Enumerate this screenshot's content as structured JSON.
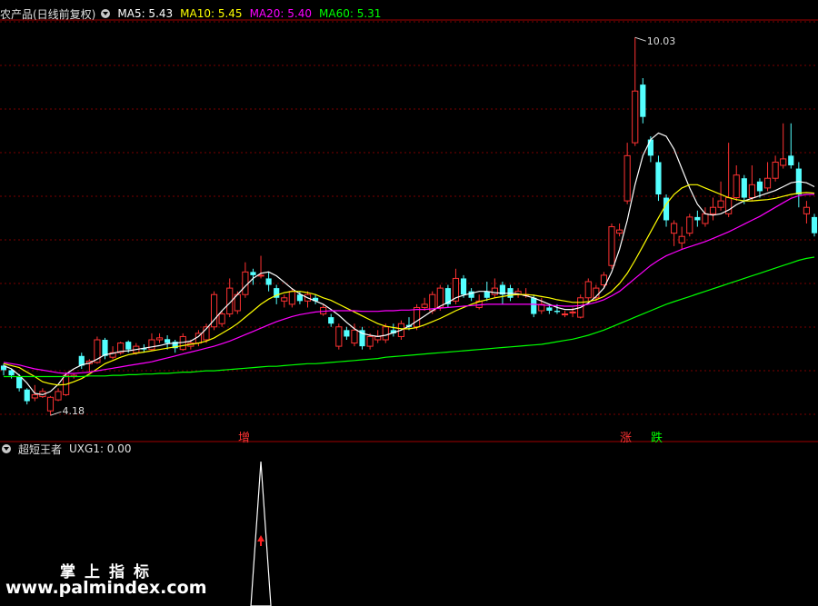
{
  "header": {
    "title": "农产品(日线前复权)",
    "ma5": "MA5: 5.43",
    "ma10": "MA10: 5.45",
    "ma20": "MA20: 5.40",
    "ma60": "MA60: 5.31",
    "colors": {
      "title": "#e0e0e0",
      "ma5": "#ffffff",
      "ma10": "#ffff00",
      "ma20": "#ff00ff",
      "ma60": "#00ff00"
    }
  },
  "indicator": {
    "name": "超短王者",
    "value": "UXG1: 0.00"
  },
  "signals": {
    "zeng": "增",
    "zhang": "涨",
    "die": "跌"
  },
  "watermark": {
    "line1": "掌上指标",
    "line2": "www.palmindex.com"
  },
  "chart_data": {
    "type": "candlestick",
    "ylim": [
      4.0,
      10.3
    ],
    "high_label": "10.03",
    "low_label": "4.18",
    "up_color": "#ff3232",
    "down_color": "#54ffff",
    "candles": [
      [
        4.95,
        4.88,
        4.98,
        4.8
      ],
      [
        4.88,
        4.8,
        4.9,
        4.75
      ],
      [
        4.78,
        4.6,
        4.82,
        4.55
      ],
      [
        4.58,
        4.4,
        4.6,
        4.35
      ],
      [
        4.45,
        4.5,
        4.65,
        4.4
      ],
      [
        4.47,
        4.55,
        4.6,
        4.45
      ],
      [
        4.25,
        4.46,
        4.48,
        4.18
      ],
      [
        4.42,
        4.55,
        4.6,
        4.4
      ],
      [
        4.5,
        4.8,
        4.85,
        4.48
      ],
      [
        4.78,
        4.8,
        4.82,
        4.75
      ],
      [
        5.1,
        4.95,
        5.15,
        4.9
      ],
      [
        4.98,
        5.02,
        5.05,
        4.85
      ],
      [
        5.0,
        5.35,
        5.4,
        4.98
      ],
      [
        5.35,
        5.1,
        5.38,
        5.05
      ],
      [
        5.08,
        5.15,
        5.25,
        5.05
      ],
      [
        5.15,
        5.3,
        5.32,
        5.12
      ],
      [
        5.32,
        5.2,
        5.34,
        5.15
      ],
      [
        5.15,
        5.25,
        5.3,
        5.12
      ],
      [
        5.22,
        5.2,
        5.28,
        5.15
      ],
      [
        5.2,
        5.35,
        5.45,
        5.18
      ],
      [
        5.35,
        5.38,
        5.45,
        5.3
      ],
      [
        5.36,
        5.3,
        5.42,
        5.2
      ],
      [
        5.32,
        5.22,
        5.35,
        5.15
      ],
      [
        5.2,
        5.4,
        5.45,
        5.18
      ],
      [
        5.25,
        5.3,
        5.35,
        5.2
      ],
      [
        5.3,
        5.45,
        5.5,
        5.25
      ],
      [
        5.35,
        5.55,
        5.6,
        5.3
      ],
      [
        5.55,
        6.05,
        6.1,
        5.5
      ],
      [
        5.6,
        5.75,
        5.8,
        5.55
      ],
      [
        5.75,
        6.15,
        6.3,
        5.7
      ],
      [
        5.8,
        6.05,
        6.1,
        5.75
      ],
      [
        6.05,
        6.4,
        6.55,
        6.0
      ],
      [
        6.4,
        6.35,
        6.45,
        6.2
      ],
      [
        6.35,
        6.35,
        6.65,
        6.3
      ],
      [
        6.3,
        6.2,
        6.4,
        6.1
      ],
      [
        6.15,
        6.0,
        6.2,
        5.9
      ],
      [
        5.95,
        6.0,
        6.05,
        5.85
      ],
      [
        5.9,
        6.1,
        6.15,
        5.85
      ],
      [
        6.05,
        5.95,
        6.1,
        5.9
      ],
      [
        5.95,
        6.05,
        6.1,
        5.85
      ],
      [
        6.0,
        5.95,
        6.05,
        5.9
      ],
      [
        5.75,
        5.85,
        5.9,
        5.72
      ],
      [
        5.7,
        5.6,
        5.75,
        5.55
      ],
      [
        5.25,
        5.55,
        5.6,
        5.2
      ],
      [
        5.5,
        5.4,
        5.55,
        5.35
      ],
      [
        5.3,
        5.5,
        5.6,
        5.25
      ],
      [
        5.5,
        5.25,
        5.55,
        5.2
      ],
      [
        5.25,
        5.4,
        5.45,
        5.2
      ],
      [
        5.35,
        5.4,
        5.5,
        5.3
      ],
      [
        5.35,
        5.55,
        5.6,
        5.3
      ],
      [
        5.5,
        5.45,
        5.6,
        5.4
      ],
      [
        5.4,
        5.6,
        5.65,
        5.35
      ],
      [
        5.58,
        5.55,
        5.7,
        5.5
      ],
      [
        5.55,
        5.85,
        5.9,
        5.5
      ],
      [
        5.85,
        5.9,
        6.0,
        5.8
      ],
      [
        5.8,
        6.05,
        6.1,
        5.75
      ],
      [
        5.85,
        6.15,
        6.2,
        5.8
      ],
      [
        6.15,
        5.9,
        6.2,
        5.85
      ],
      [
        5.95,
        6.3,
        6.45,
        5.9
      ],
      [
        6.3,
        6.05,
        6.35,
        6.0
      ],
      [
        6.1,
        6.0,
        6.15,
        5.95
      ],
      [
        5.85,
        5.95,
        6.05,
        5.82
      ],
      [
        6.1,
        6.0,
        6.25,
        5.95
      ],
      [
        6.05,
        6.15,
        6.3,
        6.0
      ],
      [
        6.2,
        6.05,
        6.25,
        5.9
      ],
      [
        6.15,
        6.0,
        6.2,
        5.95
      ],
      [
        6.05,
        6.1,
        6.15,
        6.0
      ],
      [
        6.05,
        6.05,
        6.15,
        6.0
      ],
      [
        6.0,
        5.75,
        6.05,
        5.7
      ],
      [
        5.8,
        5.9,
        6.0,
        5.75
      ],
      [
        5.85,
        5.8,
        5.9,
        5.75
      ],
      [
        5.8,
        5.78,
        5.9,
        5.75
      ],
      [
        5.75,
        5.75,
        5.8,
        5.7
      ],
      [
        5.78,
        5.78,
        5.85,
        5.7
      ],
      [
        5.7,
        6.0,
        6.05,
        5.68
      ],
      [
        6.0,
        6.25,
        6.3,
        5.95
      ],
      [
        6.0,
        6.15,
        6.2,
        5.95
      ],
      [
        6.2,
        6.35,
        6.4,
        6.15
      ],
      [
        6.5,
        7.1,
        7.15,
        6.45
      ],
      [
        7.0,
        7.05,
        7.15,
        6.95
      ],
      [
        7.5,
        8.2,
        8.4,
        7.45
      ],
      [
        8.4,
        9.2,
        10.03,
        8.35
      ],
      [
        9.3,
        8.8,
        9.4,
        8.7
      ],
      [
        8.45,
        8.2,
        8.5,
        8.1
      ],
      [
        8.1,
        7.6,
        8.2,
        7.5
      ],
      [
        7.55,
        7.2,
        7.6,
        7.1
      ],
      [
        7.0,
        7.15,
        7.2,
        6.8
      ],
      [
        6.85,
        6.95,
        7.1,
        6.75
      ],
      [
        7.0,
        7.25,
        7.3,
        6.95
      ],
      [
        7.25,
        7.2,
        7.35,
        7.1
      ],
      [
        7.15,
        7.3,
        7.4,
        7.1
      ],
      [
        7.3,
        7.4,
        7.55,
        7.2
      ],
      [
        7.4,
        7.5,
        7.8,
        7.35
      ],
      [
        7.3,
        7.55,
        8.4,
        7.25
      ],
      [
        7.55,
        7.9,
        8.05,
        7.5
      ],
      [
        7.85,
        7.55,
        7.9,
        7.45
      ],
      [
        7.55,
        7.75,
        8.05,
        7.5
      ],
      [
        7.8,
        7.65,
        7.85,
        7.55
      ],
      [
        7.7,
        7.85,
        8.1,
        7.65
      ],
      [
        7.85,
        8.1,
        8.2,
        7.8
      ],
      [
        8.05,
        8.15,
        8.7,
        8.0
      ],
      [
        8.2,
        8.05,
        8.7,
        8.0
      ],
      [
        8.0,
        7.6,
        8.1,
        7.4
      ],
      [
        7.3,
        7.4,
        7.5,
        7.15
      ],
      [
        7.25,
        7.0,
        7.3,
        6.95
      ]
    ],
    "ma": [
      {
        "name": "MA5",
        "color": "#ffffff",
        "values": [
          4.95,
          4.9,
          4.8,
          4.68,
          4.52,
          4.5,
          4.55,
          4.66,
          4.82,
          4.9,
          4.96,
          4.99,
          5.05,
          5.12,
          5.14,
          5.17,
          5.18,
          5.2,
          5.22,
          5.24,
          5.26,
          5.29,
          5.3,
          5.31,
          5.33,
          5.4,
          5.52,
          5.66,
          5.8,
          5.92,
          6.05,
          6.18,
          6.3,
          6.38,
          6.4,
          6.34,
          6.24,
          6.14,
          6.06,
          6.0,
          5.95,
          5.9,
          5.82,
          5.73,
          5.62,
          5.52,
          5.45,
          5.42,
          5.4,
          5.42,
          5.46,
          5.5,
          5.56,
          5.64,
          5.72,
          5.8,
          5.87,
          5.93,
          6.0,
          6.04,
          6.07,
          6.1,
          6.1,
          6.08,
          6.07,
          6.07,
          6.06,
          6.03,
          6.0,
          5.95,
          5.9,
          5.85,
          5.82,
          5.82,
          5.85,
          5.92,
          6.02,
          6.15,
          6.4,
          6.75,
          7.2,
          7.75,
          8.2,
          8.45,
          8.55,
          8.5,
          8.3,
          8.0,
          7.7,
          7.45,
          7.3,
          7.28,
          7.3,
          7.36,
          7.44,
          7.5,
          7.54,
          7.58,
          7.62,
          7.66,
          7.72,
          7.78,
          7.8,
          7.78,
          7.72
        ]
      },
      {
        "name": "MA10",
        "color": "#ffff00",
        "values": [
          4.98,
          4.95,
          4.92,
          4.85,
          4.78,
          4.7,
          4.67,
          4.65,
          4.66,
          4.7,
          4.75,
          4.82,
          4.9,
          4.98,
          5.03,
          5.08,
          5.12,
          5.14,
          5.16,
          5.18,
          5.2,
          5.22,
          5.24,
          5.26,
          5.28,
          5.3,
          5.33,
          5.38,
          5.45,
          5.52,
          5.6,
          5.7,
          5.8,
          5.9,
          5.98,
          6.04,
          6.08,
          6.1,
          6.1,
          6.08,
          6.05,
          6.0,
          5.96,
          5.9,
          5.84,
          5.78,
          5.72,
          5.66,
          5.6,
          5.56,
          5.54,
          5.52,
          5.52,
          5.54,
          5.58,
          5.63,
          5.68,
          5.74,
          5.8,
          5.85,
          5.9,
          5.94,
          5.97,
          6.0,
          6.02,
          6.04,
          6.05,
          6.05,
          6.04,
          6.02,
          6.0,
          5.97,
          5.95,
          5.93,
          5.93,
          5.94,
          5.97,
          6.02,
          6.1,
          6.22,
          6.38,
          6.58,
          6.8,
          7.02,
          7.24,
          7.45,
          7.6,
          7.7,
          7.75,
          7.75,
          7.7,
          7.65,
          7.6,
          7.55,
          7.52,
          7.5,
          7.5,
          7.51,
          7.52,
          7.54,
          7.57,
          7.6,
          7.62,
          7.63,
          7.62
        ]
      },
      {
        "name": "MA20",
        "color": "#ff00ff",
        "values": [
          5.0,
          4.98,
          4.96,
          4.93,
          4.9,
          4.88,
          4.86,
          4.84,
          4.83,
          4.83,
          4.84,
          4.85,
          4.87,
          4.89,
          4.91,
          4.93,
          4.95,
          4.97,
          4.99,
          5.01,
          5.04,
          5.07,
          5.1,
          5.13,
          5.16,
          5.19,
          5.22,
          5.25,
          5.29,
          5.33,
          5.38,
          5.43,
          5.48,
          5.53,
          5.58,
          5.63,
          5.67,
          5.71,
          5.74,
          5.76,
          5.78,
          5.79,
          5.8,
          5.8,
          5.8,
          5.8,
          5.79,
          5.79,
          5.79,
          5.8,
          5.8,
          5.81,
          5.81,
          5.82,
          5.82,
          5.83,
          5.84,
          5.85,
          5.86,
          5.87,
          5.88,
          5.89,
          5.9,
          5.9,
          5.9,
          5.9,
          5.9,
          5.9,
          5.9,
          5.89,
          5.88,
          5.88,
          5.87,
          5.87,
          5.88,
          5.9,
          5.93,
          5.97,
          6.03,
          6.1,
          6.2,
          6.3,
          6.4,
          6.5,
          6.58,
          6.65,
          6.7,
          6.75,
          6.79,
          6.83,
          6.87,
          6.92,
          6.97,
          7.02,
          7.08,
          7.14,
          7.2,
          7.26,
          7.33,
          7.4,
          7.47,
          7.54,
          7.58,
          7.6,
          7.6
        ]
      },
      {
        "name": "MA60",
        "color": "#00ff00",
        "values": [
          4.78,
          4.78,
          4.78,
          4.78,
          4.78,
          4.78,
          4.78,
          4.78,
          4.78,
          4.78,
          4.78,
          4.79,
          4.79,
          4.79,
          4.8,
          4.8,
          4.81,
          4.81,
          4.82,
          4.82,
          4.83,
          4.83,
          4.84,
          4.85,
          4.85,
          4.86,
          4.87,
          4.87,
          4.88,
          4.89,
          4.9,
          4.91,
          4.92,
          4.93,
          4.94,
          4.94,
          4.95,
          4.96,
          4.97,
          4.98,
          4.98,
          4.99,
          5.0,
          5.01,
          5.02,
          5.03,
          5.04,
          5.05,
          5.06,
          5.08,
          5.09,
          5.1,
          5.11,
          5.12,
          5.13,
          5.14,
          5.15,
          5.16,
          5.17,
          5.18,
          5.19,
          5.2,
          5.21,
          5.22,
          5.23,
          5.24,
          5.25,
          5.26,
          5.27,
          5.28,
          5.3,
          5.32,
          5.34,
          5.36,
          5.39,
          5.42,
          5.46,
          5.5,
          5.55,
          5.6,
          5.65,
          5.7,
          5.75,
          5.8,
          5.85,
          5.9,
          5.94,
          5.98,
          6.02,
          6.06,
          6.1,
          6.14,
          6.18,
          6.22,
          6.26,
          6.3,
          6.34,
          6.38,
          6.42,
          6.46,
          6.5,
          6.54,
          6.58,
          6.61,
          6.63
        ]
      }
    ],
    "indicator_series": {
      "name": "UXG1",
      "spike_index": 33,
      "values_note": "0 elsewhere"
    }
  }
}
